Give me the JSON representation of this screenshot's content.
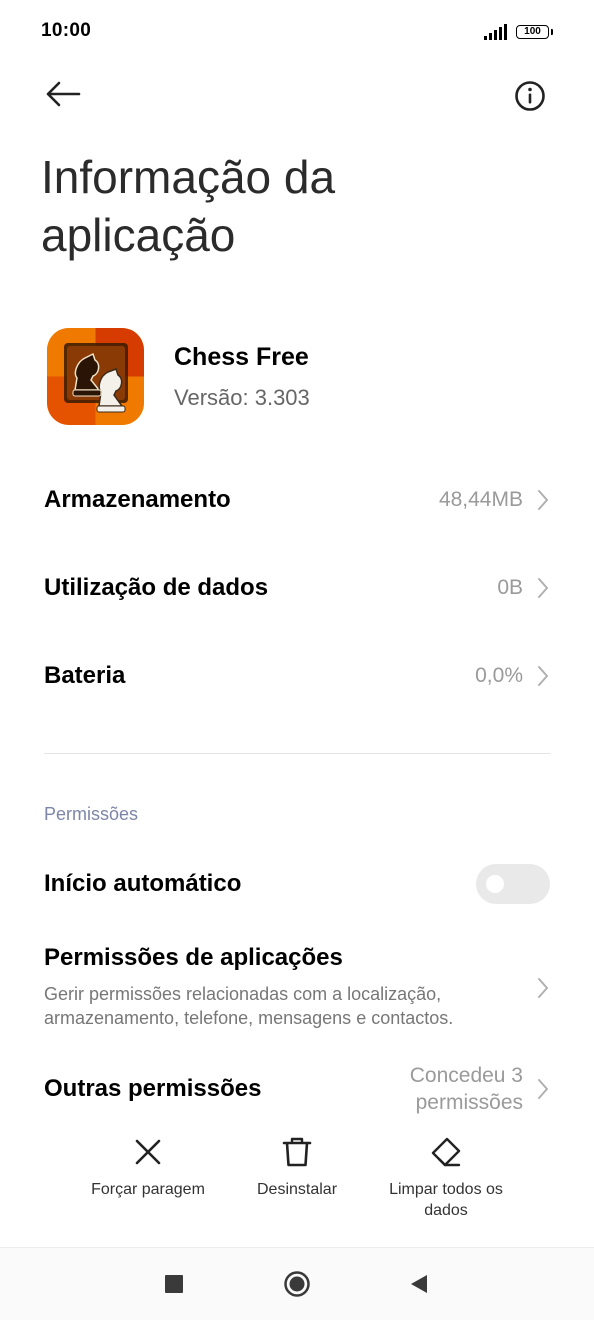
{
  "status_bar": {
    "time": "10:00",
    "battery": "100"
  },
  "header": {
    "title_line1": "Informação da",
    "title_line2": "aplicação"
  },
  "app": {
    "name": "Chess Free",
    "version": "Versão: 3.303"
  },
  "rows": [
    {
      "label": "Armazenamento",
      "value": "48,44MB"
    },
    {
      "label": "Utilização de dados",
      "value": "0B"
    },
    {
      "label": "Bateria",
      "value": "0,0%"
    }
  ],
  "permissions": {
    "section_label": "Permissões",
    "autostart_label": "Início automático",
    "autostart_enabled": false,
    "app_permissions_title": "Permissões de aplicações",
    "app_permissions_desc": "Gerir permissões relacionadas com a localização, armazenamento, telefone, mensagens e contactos.",
    "other_label": "Outras permissões",
    "other_value_line1": "Concedeu 3",
    "other_value_line2": "permissões"
  },
  "actions": [
    {
      "label": "Forçar paragem",
      "icon": "close-icon"
    },
    {
      "label": "Desinstalar",
      "icon": "trash-icon"
    },
    {
      "label_line1": "Limpar todos os",
      "label_line2": "dados",
      "icon": "eraser-icon"
    }
  ],
  "navigation": {
    "icons": [
      "square-icon",
      "circle-home-icon",
      "triangle-back-icon"
    ]
  },
  "colors": {
    "accent_section": "#7d86a8",
    "secondary_text": "#9a9a9a",
    "toggle_off": "#e9e9e9"
  }
}
